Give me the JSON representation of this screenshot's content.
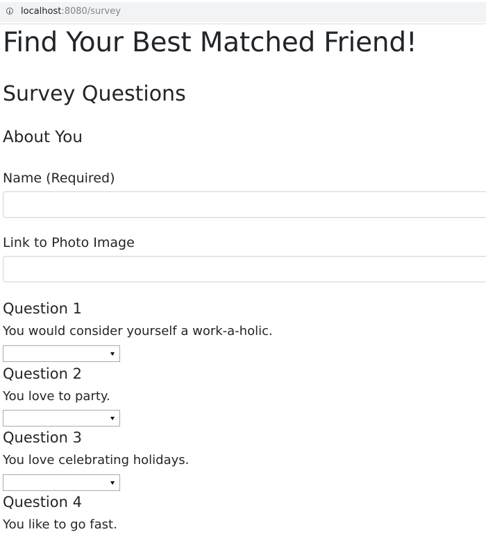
{
  "browser": {
    "url_host": "localhost",
    "url_rest": ":8080/survey",
    "info_icon": "info-icon"
  },
  "page": {
    "title": "Find Your Best Matched Friend!",
    "survey_heading": "Survey Questions",
    "about_heading": "About You",
    "name_label": "Name (Required)",
    "name_value": "",
    "photo_label": "Link to Photo Image",
    "photo_value": ""
  },
  "questions": [
    {
      "title": "Question 1",
      "text": "You would consider yourself a work-a-holic.",
      "selected": ""
    },
    {
      "title": "Question 2",
      "text": "You love to party.",
      "selected": ""
    },
    {
      "title": "Question 3",
      "text": "You love celebrating holidays.",
      "selected": ""
    },
    {
      "title": "Question 4",
      "text": "You like to go fast.",
      "selected": ""
    }
  ]
}
